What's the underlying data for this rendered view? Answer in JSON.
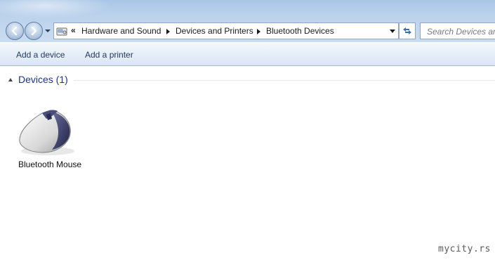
{
  "address_bar": {
    "breadcrumbs": [
      "Hardware and Sound",
      "Devices and Printers",
      "Bluetooth Devices"
    ],
    "overflow_chevron": "«"
  },
  "search": {
    "placeholder": "Search Devices and"
  },
  "toolbar": {
    "add_device_label": "Add a device",
    "add_printer_label": "Add a printer"
  },
  "devices_group": {
    "title": "Devices (1)",
    "items": [
      {
        "label": "Bluetooth Mouse",
        "icon": "mouse-icon"
      }
    ]
  },
  "watermark": "mycity.rs",
  "colors": {
    "accent_text": "#1e3287",
    "command_text": "#1e395b"
  }
}
